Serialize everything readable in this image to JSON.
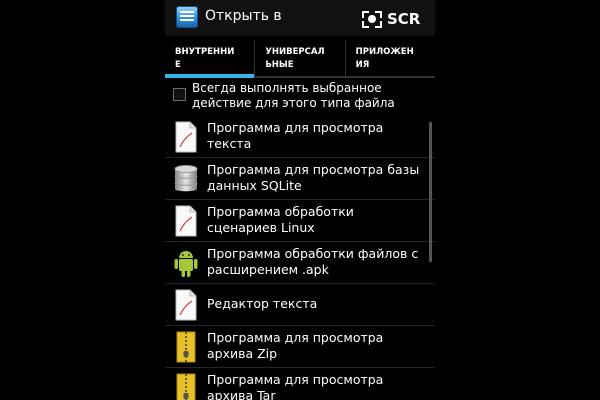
{
  "action_bar": {
    "title": "Открыть в",
    "scr_label": "SCR"
  },
  "tabs": [
    {
      "label": "ВНУТРЕННИ\nЕ",
      "active": true
    },
    {
      "label": "УНИВЕРСАЛ\nЬНЫЕ",
      "active": false
    },
    {
      "label": "ПРИЛОЖЕН\nИЯ",
      "active": false
    }
  ],
  "always_use": {
    "label": "Всегда выполнять выбранное действие для этого типа файла",
    "checked": false
  },
  "apps": [
    {
      "label": "Программа для просмотра\nтекста",
      "icon": "document-icon"
    },
    {
      "label": "Программа для просмотра базы\nданных SQLite",
      "icon": "database-icon"
    },
    {
      "label": "Программа обработки\nсценариев Linux",
      "icon": "document-icon"
    },
    {
      "label": "Программа обработки файлов с\nрасширением .apk",
      "icon": "android-icon"
    },
    {
      "label": "Редактор текста",
      "icon": "document-icon"
    },
    {
      "label": "Программа для просмотра\nархива Zip",
      "icon": "zip-archive-icon"
    },
    {
      "label": "Программа для просмотра\nархива Tar",
      "icon": "zip-archive-icon"
    }
  ],
  "colors": {
    "accent": "#33b5e5",
    "android_green": "#a4c639",
    "archive_yellow": "#e8c12a"
  }
}
